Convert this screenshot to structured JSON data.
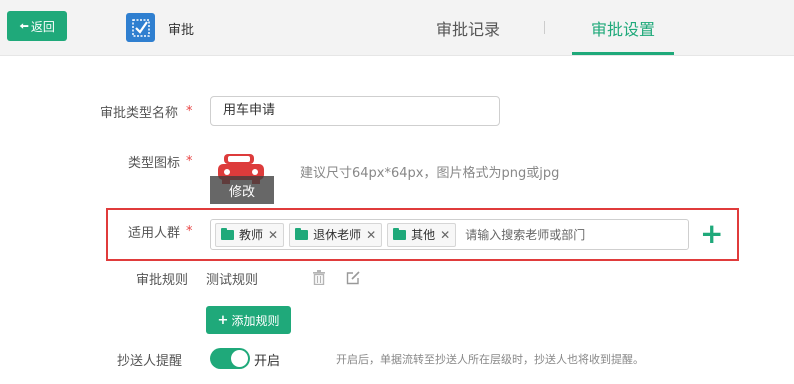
{
  "header": {
    "back_label": "返回",
    "app_title": "审批",
    "tabs": [
      {
        "label": "审批记录",
        "active": false
      },
      {
        "label": "审批设置",
        "active": true
      }
    ]
  },
  "form": {
    "type_name": {
      "label": "审批类型名称",
      "required": true,
      "value": "用车申请"
    },
    "type_icon": {
      "label": "类型图标",
      "required": true,
      "icon": "car-icon",
      "edit_label": "修改",
      "hint": "建议尺寸64px*64px，图片格式为png或jpg"
    },
    "audience": {
      "label": "适用人群",
      "required": true,
      "chips": [
        {
          "label": "教师",
          "icon": "folder-icon"
        },
        {
          "label": "退休老师",
          "icon": "folder-icon"
        },
        {
          "label": "其他",
          "icon": "folder-icon"
        }
      ],
      "placeholder": "请输入搜索老师或部门"
    },
    "rules": {
      "label": "审批规则",
      "items": [
        {
          "name": "测试规则"
        }
      ],
      "add_label": "添加规则"
    },
    "cc_reminder": {
      "label": "抄送人提醒",
      "enabled": true,
      "state_label": "开启",
      "hint": "开启后，单据流转至抄送人所在层级时，抄送人也将收到提醒。"
    }
  },
  "colors": {
    "accent": "#1fa97a",
    "highlight_border": "#e03b3b",
    "required": "#e94444",
    "app_icon_bg": "#2f7fd0"
  }
}
